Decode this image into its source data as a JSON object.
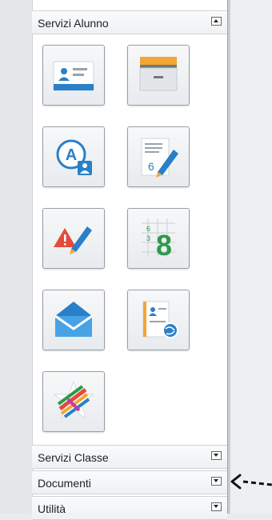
{
  "sidebar": {
    "sections": [
      {
        "label": "Servizi Alunno",
        "expanded": true
      },
      {
        "label": "Servizi Classe",
        "expanded": false
      },
      {
        "label": "Documenti",
        "expanded": false
      },
      {
        "label": "Utilità",
        "expanded": false
      }
    ],
    "tiles": [
      {
        "icon": "student-id-card-icon"
      },
      {
        "icon": "file-drawer-icon"
      },
      {
        "icon": "attendance-a-icon"
      },
      {
        "icon": "grades-notebook-icon"
      },
      {
        "icon": "notes-warning-icon"
      },
      {
        "icon": "grid-grades-icon"
      },
      {
        "icon": "mail-envelope-icon"
      },
      {
        "icon": "contact-globe-icon"
      },
      {
        "icon": "colorful-star-icon"
      }
    ],
    "tile_texts": {
      "grades_digit": "6",
      "grid_small_top": "6",
      "grid_small_bottom": "3",
      "grid_big": "8"
    }
  },
  "colors": {
    "accent_blue": "#2a7fc9",
    "panel_bg": "#ffffff",
    "header_bg": "#f3f5f7"
  }
}
